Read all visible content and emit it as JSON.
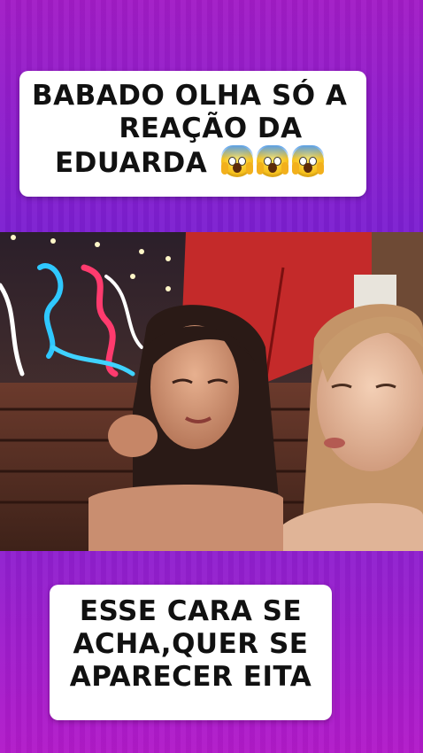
{
  "top_caption": {
    "line1": "BABADO OLHA SÓ A",
    "line2": "REAÇÃO DA",
    "line3": "EDUARDA",
    "emojis": [
      "face-screaming-in-fear-icon",
      "face-screaming-in-fear-icon",
      "face-screaming-in-fear-icon"
    ]
  },
  "bottom_caption": {
    "line1": "ESSE CARA SE",
    "line2": "ACHA,QUER SE",
    "line3": "APARECER EITA"
  },
  "colors": {
    "background_top": "#a21cc6",
    "background_mid": "#7d1fd1",
    "caption_bg": "#ffffff",
    "caption_text": "#111111"
  }
}
